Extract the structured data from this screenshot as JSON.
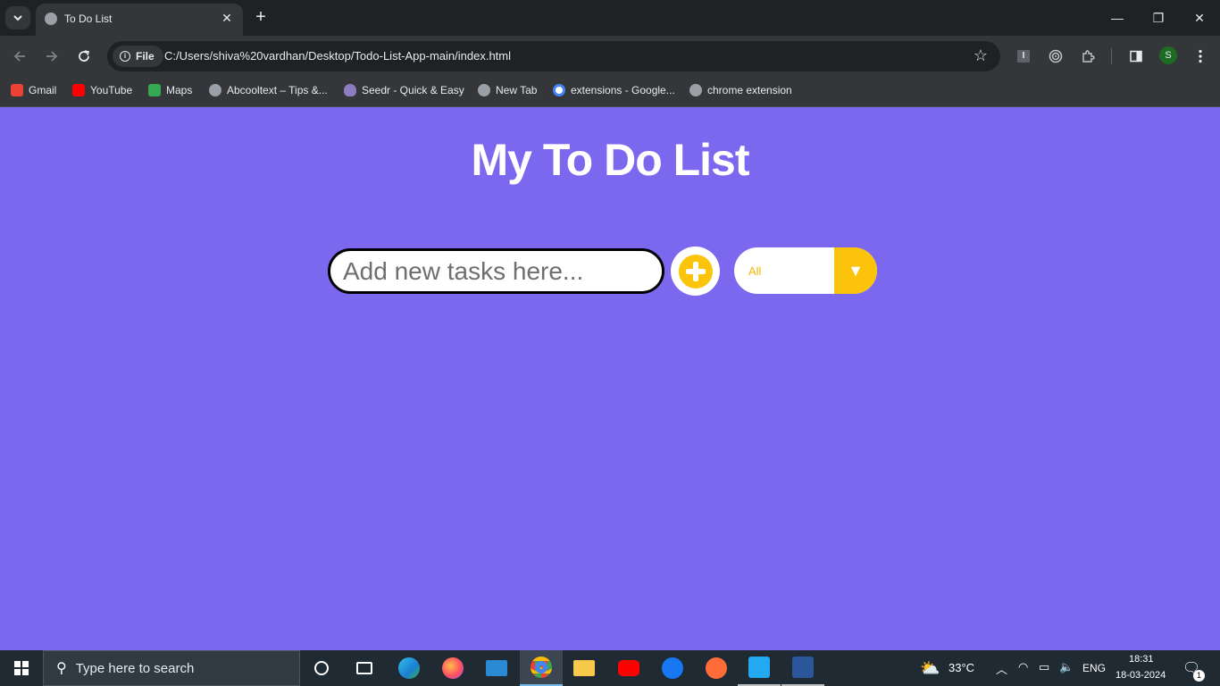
{
  "browser": {
    "tab_title": "To Do List",
    "new_tab_label": "+",
    "omnibox_chip": "File",
    "url": "C:/Users/shiva%20vardhan/Desktop/Todo-List-App-main/index.html",
    "profile_initial": "S",
    "extension_letter": "I",
    "window_controls": {
      "minimize": "—",
      "restore": "❐",
      "close": "✕"
    }
  },
  "bookmarks": [
    {
      "label": "Gmail",
      "color": "#ea4335"
    },
    {
      "label": "YouTube",
      "color": "#ff0000"
    },
    {
      "label": "Maps",
      "color": "#34a853"
    },
    {
      "label": "Abcooltext – Tips &...",
      "color": "#9aa0a6"
    },
    {
      "label": "Seedr - Quick & Easy",
      "color": "#8e7cc3"
    },
    {
      "label": "New Tab",
      "color": "#9aa0a6"
    },
    {
      "label": "extensions - Google...",
      "color": "#4285f4"
    },
    {
      "label": "chrome extension",
      "color": "#9aa0a6"
    }
  ],
  "app": {
    "title": "My To Do List",
    "input_placeholder": "Add new tasks here...",
    "filter_selected": "All",
    "filter_arrow": "▼",
    "colors": {
      "background": "#7b68ee",
      "accent": "#fcc30b"
    }
  },
  "taskbar": {
    "search_placeholder": "Type here to search",
    "weather": "33°C",
    "language": "ENG",
    "time": "18:31",
    "date": "18-03-2024",
    "notification_count": "1"
  }
}
